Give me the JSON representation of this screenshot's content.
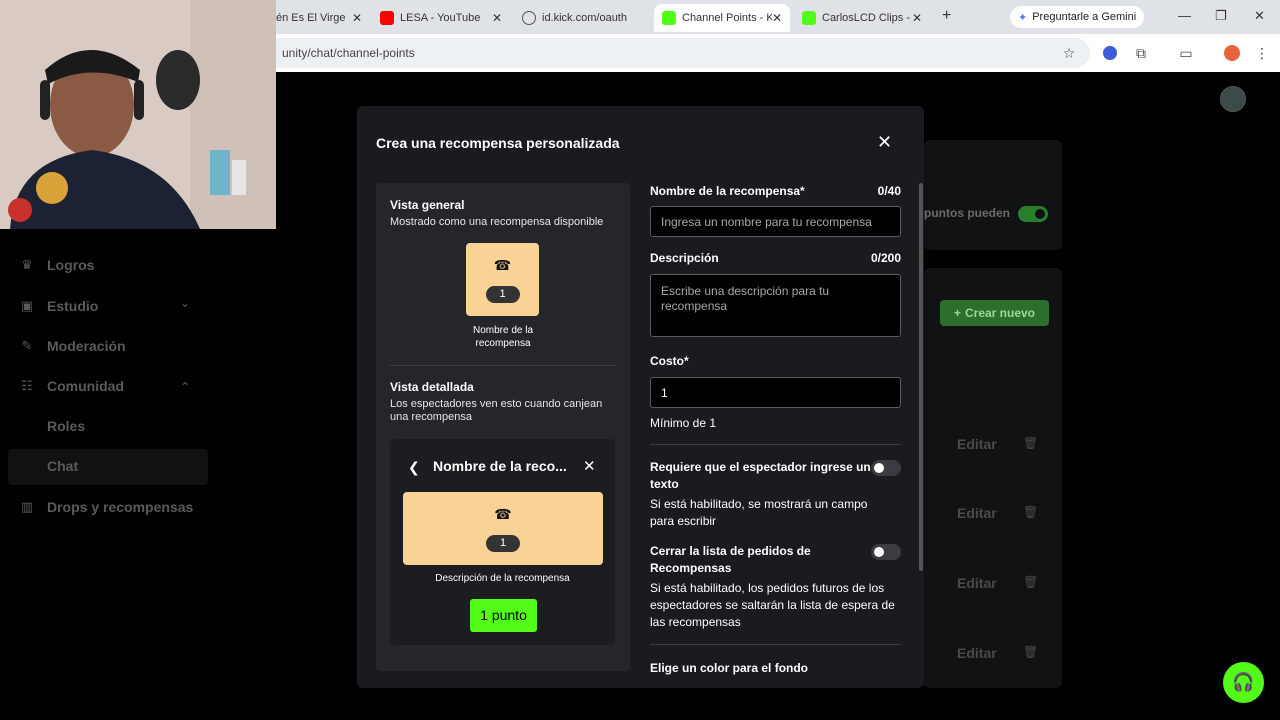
{
  "browser": {
    "tabs": [
      {
        "title": "én Es El Virge",
        "active": false,
        "icon": "page-icon"
      },
      {
        "title": "LESA - YouTube",
        "active": false,
        "icon": "youtube-icon"
      },
      {
        "title": "id.kick.com/oauth",
        "active": false,
        "icon": "globe-icon"
      },
      {
        "title": "Channel Points - K",
        "active": true,
        "icon": "kick-icon"
      },
      {
        "title": "CarlosLCD Clips - ",
        "active": false,
        "icon": "kick-icon"
      }
    ],
    "new_tab": "+",
    "gemini_label": "Preguntarle a Gemini",
    "url": "unity/chat/channel-points"
  },
  "sidebar": {
    "items": [
      {
        "label": "Logros",
        "icon": "trophy-icon"
      },
      {
        "label": "Estudio",
        "icon": "studio-icon",
        "chevron": "⌄"
      },
      {
        "label": "Moderación",
        "icon": "wrench-icon"
      },
      {
        "label": "Comunidad",
        "icon": "community-icon",
        "chevron": "⌃"
      },
      {
        "label": "Drops y recompensas",
        "icon": "drops-icon"
      }
    ],
    "subitems": [
      {
        "label": "Roles"
      },
      {
        "label": "Chat"
      }
    ]
  },
  "background": {
    "toggle_text": "puntos pueden",
    "create_button": "Crear nuevo",
    "edit_label": "Editar"
  },
  "modal": {
    "title": "Crea una recompensa personalizada",
    "preview": {
      "general_heading": "Vista general",
      "general_sub": "Mostrado como una recompensa disponible",
      "card_cost": "1",
      "card_name": "Nombre de la recompensa",
      "detail_heading": "Vista detallada",
      "detail_sub": "Los espectadores ven esto cuando canjean una recompensa",
      "detail_title": "Nombre de la reco...",
      "detail_cost": "1",
      "detail_desc": "Descripción de la recompensa",
      "detail_button": "1 punto",
      "card_color": "#f9d396",
      "button_color": "#53fc18"
    },
    "form": {
      "name_label": "Nombre de la recompensa*",
      "name_count": "0/40",
      "name_placeholder": "Ingresa un nombre para tu recompensa",
      "desc_label": "Descripción",
      "desc_count": "0/200",
      "desc_placeholder": "Escribe una descripción para tu recompensa",
      "cost_label": "Costo*",
      "cost_value": "1",
      "cost_min": "Mínimo de 1",
      "require_text_title": "Requiere que el espectador ingrese un texto",
      "require_text_sub": "Si está habilitado, se mostrará un campo para escribir",
      "close_queue_title": "Cerrar la lista de pedidos de Recompensas",
      "close_queue_sub": "Si está habilitado, los pedidos futuros de los espectadores se saltarán la lista de espera de las recompensas",
      "bg_color_label": "Elige un color para el fondo"
    }
  },
  "colors": {
    "accent": "#53fc18",
    "modal_bg": "#191b1f"
  }
}
